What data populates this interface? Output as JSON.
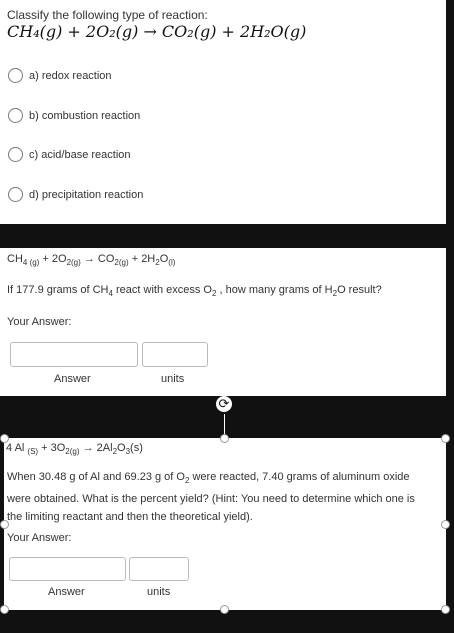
{
  "q1": {
    "label": "Classify the following type of reaction:",
    "equation": "CH₄(g) + 2O₂(g) → CO₂(g) + 2H₂O(g)",
    "options": [
      "a) redox reaction",
      "b) combustion reaction",
      "c) acid/base reaction",
      "d) precipitation reaction"
    ]
  },
  "q2": {
    "equation": {
      "ch": "CH",
      "ch_sub": "4 (g)",
      "plus1": " + 2O",
      "o_sub": "2(g)",
      "arrow": " → ",
      "co": "CO",
      "co_sub": "2(g)",
      "plus2": " + 2H",
      "h_sub": "2",
      "o": "O",
      "o2_sub": "(l)"
    },
    "question": {
      "p1": "If 177.9 grams of CH",
      "s1": "4",
      "p2": " react with excess O",
      "s2": "2",
      "p3": " , how many grams of H",
      "s3": "2",
      "p4": "O result?"
    },
    "your_answer": "Your Answer:",
    "answer_label": "Answer",
    "units_label": "units"
  },
  "q3": {
    "equation": {
      "al": "4 Al ",
      "al_sub": "(S)",
      "plus": " + 3O",
      "o_sub": "2(g)",
      "arrow": " → ",
      "prod": "2Al",
      "prod_sub1": "2",
      "prod_mid": "O",
      "prod_sub2": "3",
      "prod_end": "(s)"
    },
    "question": {
      "p1": "When  30.48 g of Al and 69.23 g of O",
      "s1": "2",
      "p2": " were reacted, 7.40 grams of aluminum oxide were obtained. What is the percent yield? (Hint: You need to determine which one is the limiting reactant and then the theoretical yield)."
    },
    "your_answer": "Your Answer:",
    "answer_label": "Answer",
    "units_label": "units"
  },
  "icons": {
    "rotate": "rotate-icon"
  },
  "colors": {
    "background": "#111111",
    "card": "#ffffff",
    "text": "#333333"
  }
}
